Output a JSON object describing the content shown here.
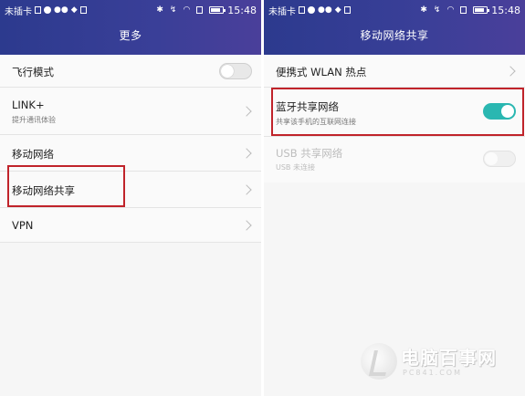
{
  "left": {
    "status": {
      "carrier": "未插卡",
      "time": "15:48"
    },
    "title": "更多",
    "items": [
      {
        "title": "飞行模式"
      },
      {
        "title": "LINK+",
        "subtitle": "提升通讯体验"
      },
      {
        "title": "移动网络"
      },
      {
        "title": "移动网络共享"
      },
      {
        "title": "VPN"
      }
    ],
    "toggle_airplane": "off"
  },
  "right": {
    "status": {
      "carrier": "未插卡",
      "time": "15:48"
    },
    "title": "移动网络共享",
    "items": [
      {
        "title": "便携式 WLAN 热点"
      },
      {
        "title": "蓝牙共享网络",
        "subtitle": "共享该手机的互联网连接",
        "toggle": "on"
      },
      {
        "title": "USB 共享网络",
        "subtitle": "USB 未连接",
        "toggle": "disabled"
      }
    ]
  },
  "watermark": {
    "text": "电脑百事网",
    "sub": "PC841.COM"
  },
  "colors": {
    "appbar": "#33398f",
    "accent_toggle": "#2ab7b1",
    "highlight": "#c0232a"
  }
}
